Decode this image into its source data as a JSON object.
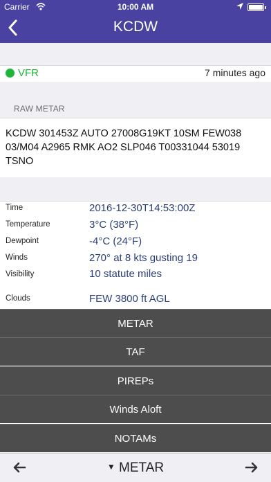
{
  "status_bar": {
    "carrier": "Carrier",
    "time": "10:00 AM"
  },
  "nav": {
    "title": "KCDW"
  },
  "flight_category": {
    "label": "VFR",
    "color": "#1eb53a",
    "updated": "7 minutes ago"
  },
  "raw_metar": {
    "header": "RAW METAR",
    "text": "KCDW 301453Z AUTO 27008G19KT 10SM FEW038 03/M04 A2965 RMK AO2 SLP046 T00331044 53019 TSNO"
  },
  "details": [
    {
      "label": "Time",
      "value": "2016-12-30T14:53:00Z"
    },
    {
      "label": "Temperature",
      "value": "3°C (38°F)"
    },
    {
      "label": "Dewpoint",
      "value": "-4°C (24°F)"
    },
    {
      "label": "Winds",
      "value": "270° at 8 kts gusting 19"
    },
    {
      "label": "Visibility",
      "value": "10 statute miles"
    },
    {
      "label": "Clouds",
      "value": "FEW 3800 ft AGL"
    }
  ],
  "menu": [
    "METAR",
    "TAF",
    "PIREPs",
    "Winds Aloft",
    "NOTAMs"
  ],
  "bottom": {
    "selected": "METAR"
  },
  "colors": {
    "header_bg": "#4a42a0",
    "menu_bg": "#4d4d4d",
    "value_text": "#2c3e78"
  }
}
